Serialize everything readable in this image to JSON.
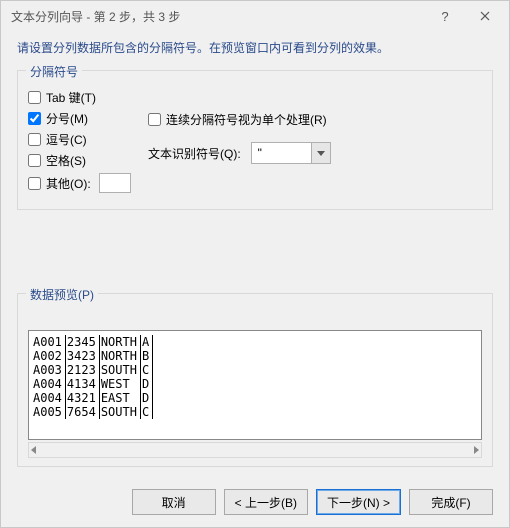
{
  "title": "文本分列向导 - 第 2 步，共 3 步",
  "instruction": "请设置分列数据所包含的分隔符号。在预览窗口内可看到分列的效果。",
  "delimiters_legend": "分隔符号",
  "delim": {
    "tab": "Tab 键(T)",
    "semicolon": "分号(M)",
    "comma": "逗号(C)",
    "space": "空格(S)",
    "other": "其他(O):"
  },
  "treat_consecutive": "连续分隔符号视为单个处理(R)",
  "qualifier_label": "文本识别符号(Q):",
  "qualifier_value": "\"",
  "preview_legend": "数据预览(P)",
  "preview_rows": [
    {
      "c0": "A001",
      "c1": "2345",
      "c2": "NORTH",
      "c3": "A"
    },
    {
      "c0": "A002",
      "c1": "3423",
      "c2": "NORTH",
      "c3": "B"
    },
    {
      "c0": "A003",
      "c1": "2123",
      "c2": "SOUTH",
      "c3": "C"
    },
    {
      "c0": "A004",
      "c1": "4134",
      "c2": "WEST",
      "c3": "D"
    },
    {
      "c0": "A004",
      "c1": "4321",
      "c2": "EAST",
      "c3": "D"
    },
    {
      "c0": "A005",
      "c1": "7654",
      "c2": "SOUTH",
      "c3": "C"
    }
  ],
  "buttons": {
    "cancel": "取消",
    "back": "< 上一步(B)",
    "next": "下一步(N) >",
    "finish": "完成(F)"
  }
}
